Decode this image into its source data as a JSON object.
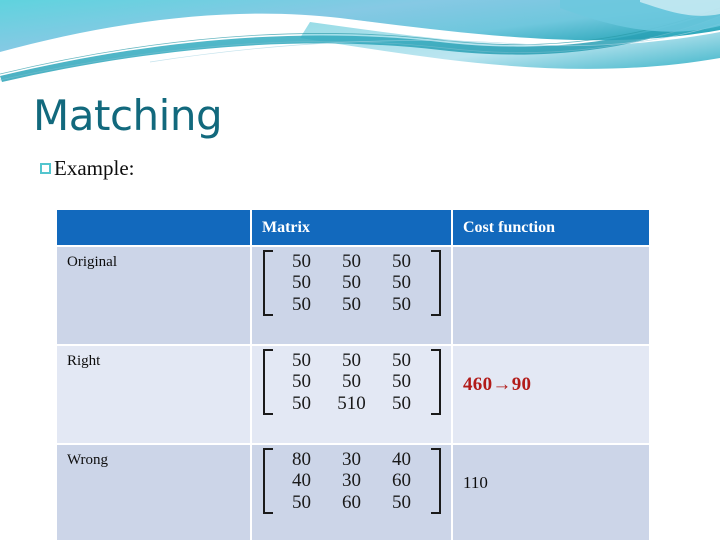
{
  "slide": {
    "title": "Matching",
    "bullet": {
      "icon": "hollow-square-bullet",
      "text": "Example:"
    }
  },
  "theme": {
    "title_color": "#12697d",
    "bullet_color": "#53c5ce",
    "header_bg": "#1269bd",
    "row_dark_bg": "#ccd5e8",
    "row_light_bg": "#e3e8f4",
    "accent_red": "#b21b19",
    "banner_cyan": "#5ecfdb",
    "banner_blue": "#7cc3e0",
    "banner_teal": "#2a9aa8"
  },
  "table": {
    "headers": [
      "",
      "Matrix",
      "Cost function"
    ],
    "rows": [
      {
        "label": "Original",
        "matrix": [
          [
            "50",
            "50",
            "50"
          ],
          [
            "50",
            "50",
            "50"
          ],
          [
            "50",
            "50",
            "50"
          ]
        ],
        "cost": "",
        "cost_style": "none",
        "shade": "dark"
      },
      {
        "label": "Right",
        "matrix": [
          [
            "50",
            "50",
            "50"
          ],
          [
            "50",
            "50",
            "50"
          ],
          [
            "50",
            "510",
            "50"
          ]
        ],
        "cost": "460→90",
        "cost_style": "red",
        "shade": "light"
      },
      {
        "label": "Wrong",
        "matrix": [
          [
            "80",
            "30",
            "40"
          ],
          [
            "40",
            "30",
            "60"
          ],
          [
            "50",
            "60",
            "50"
          ]
        ],
        "cost": "110",
        "cost_style": "black",
        "shade": "dark"
      }
    ]
  }
}
